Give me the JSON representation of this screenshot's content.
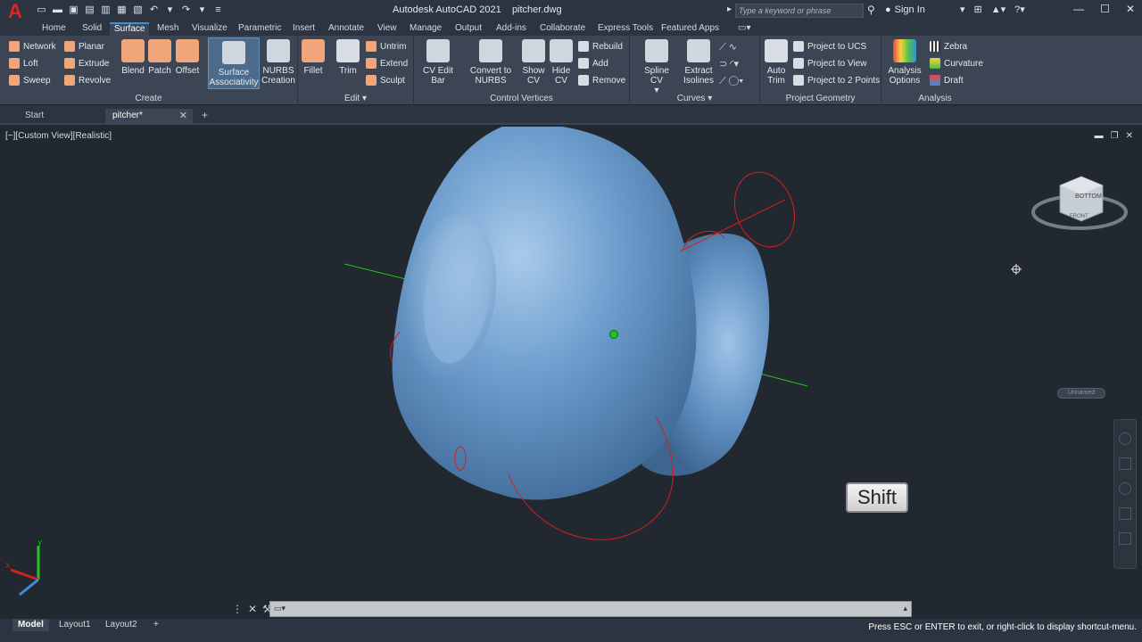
{
  "app": {
    "logo_letter": "A",
    "title": "Autodesk AutoCAD 2021",
    "filename": "pitcher.dwg",
    "search_placeholder": "Type a keyword or phrase",
    "sign_in": "Sign In"
  },
  "ribbon_tabs": [
    "Home",
    "Solid",
    "Surface",
    "Mesh",
    "Visualize",
    "Parametric",
    "Insert",
    "Annotate",
    "View",
    "Manage",
    "Output",
    "Add-ins",
    "Collaborate",
    "Express Tools",
    "Featured Apps"
  ],
  "active_ribbon_tab": "Surface",
  "ribbon": {
    "create": {
      "title": "Create",
      "small": [
        "Network",
        "Loft",
        "Sweep",
        "Planar",
        "Extrude",
        "Revolve"
      ],
      "large": [
        "Blend",
        "Patch",
        "Offset"
      ],
      "surface_assoc_1": "Surface",
      "surface_assoc_2": "Associativity",
      "nurbs_1": "NURBS",
      "nurbs_2": "Creation"
    },
    "edit": {
      "title": "Edit",
      "large": [
        "Fillet",
        "Trim"
      ],
      "small": [
        "Untrim",
        "Extend",
        "Sculpt"
      ]
    },
    "control_vertices": {
      "title": "Control Vertices",
      "cv_edit_bar": "CV Edit Bar",
      "convert_1": "Convert to",
      "convert_2": "NURBS",
      "show_1": "Show",
      "show_2": "CV",
      "hide_1": "Hide",
      "hide_2": "CV",
      "small": [
        "Rebuild",
        "Add",
        "Remove"
      ]
    },
    "curves": {
      "title": "Curves",
      "spline_cv": "Spline CV",
      "extract_1": "Extract",
      "extract_2": "Isolines"
    },
    "project_geometry": {
      "title": "Project Geometry",
      "auto_1": "Auto",
      "auto_2": "Trim",
      "small": [
        "Project to UCS",
        "Project to View",
        "Project to 2 Points"
      ]
    },
    "analysis": {
      "title": "Analysis",
      "options_1": "Analysis",
      "options_2": "Options",
      "small": [
        "Zebra",
        "Curvature",
        "Draft"
      ]
    }
  },
  "file_tabs": [
    "Start",
    "pitcher*"
  ],
  "viewport": {
    "label": "[−][Custom View][Realistic]",
    "viewcube_face": "BOTTOM",
    "viewcube_side": "FRONT",
    "ucs_label": "Unnamed",
    "shift_key": "Shift"
  },
  "layout_tabs": [
    "Model",
    "Layout1",
    "Layout2"
  ],
  "status_message": "Press ESC or ENTER to exit, or right-click to display shortcut-menu.",
  "colors": {
    "accent": "#3b8ed8",
    "surface": "#6f9fcf",
    "curve": "#d42020",
    "axis_green": "#21c421"
  }
}
